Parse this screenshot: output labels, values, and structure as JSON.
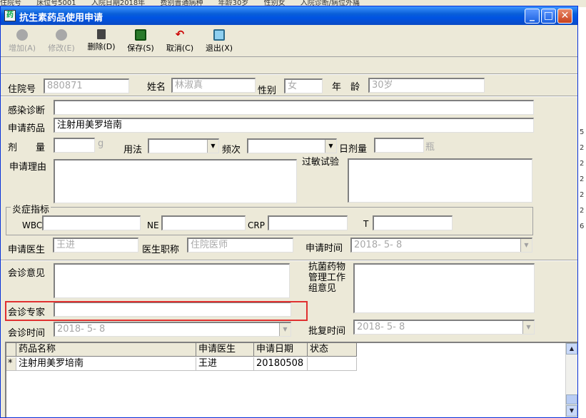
{
  "background_app": {
    "strip_texts": [
      "住院号",
      "床位号5001",
      "入院日期2018年",
      "费别普通病种",
      "年龄30岁",
      "性别女",
      "入院诊断/病位外痛"
    ],
    "right_col_cells": [
      "5",
      "2",
      "2",
      "2",
      "2",
      "2",
      "6"
    ]
  },
  "window": {
    "title": "抗生素药品使用申请",
    "controls": {
      "minimize": "_",
      "maximize": "□",
      "close": "✕"
    }
  },
  "toolbar": {
    "add": "增加(A)",
    "modify": "修改(E)",
    "delete": "删除(D)",
    "save": "保存(S)",
    "cancel": "取消(C)",
    "exit": "退出(X)"
  },
  "form": {
    "admission_no_label": "住院号",
    "admission_no": "880871",
    "name_label": "姓名",
    "name": "林淑真",
    "gender_label": "性别",
    "gender": "女",
    "age_label": "年　龄",
    "age": "30岁",
    "infection_diag_label": "感染诊断",
    "infection_diag": "",
    "drug_label": "申请药品",
    "drug": "注射用美罗培南",
    "dose_label": "剂　　量",
    "dose": "",
    "dose_unit": "g",
    "usage_label": "用法",
    "usage": "",
    "frequency_label": "频次",
    "frequency": "",
    "daily_dose_label": "日剂量",
    "daily_dose": "",
    "daily_dose_unit": "瓶",
    "reason_label": "申请理由",
    "reason": "",
    "allergy_label": "过敏试验",
    "allergy": "",
    "inflammation_label": "炎症指标",
    "wbc_label": "WBC",
    "wbc": "",
    "ne_label": "NE",
    "ne": "",
    "crp_label": "CRP",
    "crp": "",
    "t_label": "T",
    "t": "",
    "doctor_label": "申请医生",
    "doctor": "王进",
    "doctor_title_label": "医生职称",
    "doctor_title": "住院医师",
    "apply_time_label": "申请时间",
    "apply_time": "2018- 5- 8",
    "consult_opinion_label": "会诊意见",
    "consult_opinion": "",
    "mgmt_opinion_label_1": "抗菌药物",
    "mgmt_opinion_label_2": "管理工作",
    "mgmt_opinion_label_3": "组意见",
    "mgmt_opinion": "",
    "consult_expert_label": "会诊专家",
    "consult_expert": "",
    "consult_time_label": "会诊时间",
    "consult_time": "2018- 5- 8",
    "approve_time_label": "批复时间",
    "approve_time": "2018- 5- 8"
  },
  "table": {
    "columns": [
      "药品名称",
      "申请医生",
      "申请日期",
      "状态"
    ],
    "rows": [
      {
        "marker": "*",
        "drug": "注射用美罗培南",
        "doctor": "王进",
        "date": "20180508",
        "status": ""
      }
    ]
  }
}
